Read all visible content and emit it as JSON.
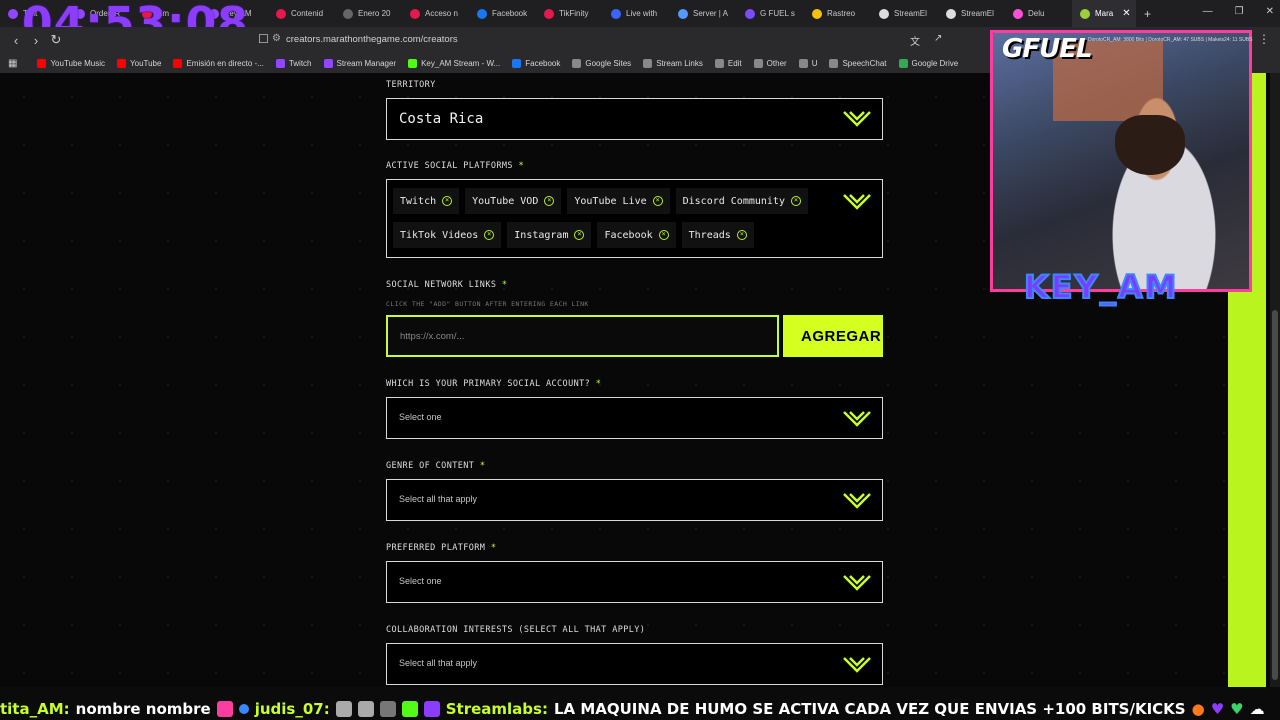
{
  "overlay": {
    "timer": "04:53:08",
    "gfuel_logo": "GFUEL",
    "streamer_name": "KEY_AM",
    "stream_stats": "DorotoCR_AM: 3800 Bits | DorotoCR_AM: 47 SUBS | Makeis24: 11 SUBS"
  },
  "tabs": [
    {
      "label": "Twit",
      "color": "#9146ff"
    },
    {
      "label": "Orden R",
      "color": "#9146ff"
    },
    {
      "label": "Em",
      "color": "#e6194b"
    },
    {
      "label": "Key AM",
      "color": "#9146ff"
    },
    {
      "label": "Contenid",
      "color": "#e6194b"
    },
    {
      "label": "Enero 20",
      "color": "#666"
    },
    {
      "label": "Acceso n",
      "color": "#e6194b"
    },
    {
      "label": "Facebook",
      "color": "#1877f2"
    },
    {
      "label": "TikFinity",
      "color": "#e6194b"
    },
    {
      "label": "Live with",
      "color": "#3a66ff"
    },
    {
      "label": "Server | A",
      "color": "#5599ff"
    },
    {
      "label": "G FUEL s",
      "color": "#7a4cff"
    },
    {
      "label": "Rastreo",
      "color": "#f4c20d"
    },
    {
      "label": "StreamEl",
      "color": "#ddd"
    },
    {
      "label": "StreamEl",
      "color": "#ddd"
    },
    {
      "label": "Delu",
      "color": "#ff4fd8"
    },
    {
      "label": "Mara",
      "color": "#9ad13b",
      "active": true
    }
  ],
  "address": {
    "url": "creators.marathonthegame.com/creators"
  },
  "bookmarks": [
    {
      "label": "YouTube Music",
      "color": "#ff0000"
    },
    {
      "label": "YouTube",
      "color": "#ff0000"
    },
    {
      "label": "Emisión en directo -...",
      "color": "#ff0000"
    },
    {
      "label": "Twitch",
      "color": "#9146ff"
    },
    {
      "label": "Stream Manager",
      "color": "#9146ff"
    },
    {
      "label": "Key_AM Stream - W...",
      "color": "#53fc18"
    },
    {
      "label": "Facebook",
      "color": "#1877f2"
    },
    {
      "label": "Google Sites",
      "color": "#888"
    },
    {
      "label": "Stream Links",
      "color": "#888"
    },
    {
      "label": "Edit",
      "color": "#888"
    },
    {
      "label": "Other",
      "color": "#888"
    },
    {
      "label": "U",
      "color": "#888"
    },
    {
      "label": "SpeechChat",
      "color": "#888"
    },
    {
      "label": "Google Drive",
      "color": "#34a853"
    }
  ],
  "form": {
    "territory": {
      "label": "TERRITORY",
      "value": "Costa Rica"
    },
    "platforms": {
      "label": "ACTIVE SOCIAL PLATFORMS",
      "required": "*",
      "chips": [
        "Twitch",
        "YouTube VOD",
        "YouTube Live",
        "Discord Community",
        "TikTok Videos",
        "Instagram",
        "Facebook",
        "Threads"
      ]
    },
    "links": {
      "label": "SOCIAL NETWORK LINKS",
      "required": "*",
      "hint": "CLICK THE \"ADD\" BUTTON AFTER ENTERING EACH LINK",
      "placeholder": "https://x.com/...",
      "add_button": "AGREGAR"
    },
    "primary": {
      "label": "WHICH IS YOUR PRIMARY SOCIAL ACCOUNT?",
      "required": "*",
      "placeholder": "Select one"
    },
    "genre": {
      "label": "GENRE OF CONTENT",
      "required": "*",
      "placeholder": "Select all that apply"
    },
    "preferred": {
      "label": "PREFERRED PLATFORM",
      "required": "*",
      "placeholder": "Select one"
    },
    "collab": {
      "label": "COLLABORATION INTERESTS (SELECT ALL THAT APPLY)",
      "placeholder": "Select all that apply"
    }
  },
  "ticker": {
    "user1": "tita_AM:",
    "msg1": "nombre nombre",
    "user2": "judis_07:",
    "user3": "Streamlabs:",
    "msg3": "LA MAQUINA DE HUMO SE ACTIVA CADA VEZ QUE ENVIAS +100 BITS/KICKS"
  },
  "colors": {
    "accent": "#c8ff2a",
    "timer": "#8c3cff",
    "cam_border": "#ff3ca0"
  },
  "icons": [
    "back-icon",
    "forward-icon",
    "reload-icon",
    "bookmark-icon",
    "translate-icon",
    "share-icon",
    "chevron-down-icon",
    "remove-chip-icon",
    "apps-icon",
    "new-tab-icon"
  ]
}
